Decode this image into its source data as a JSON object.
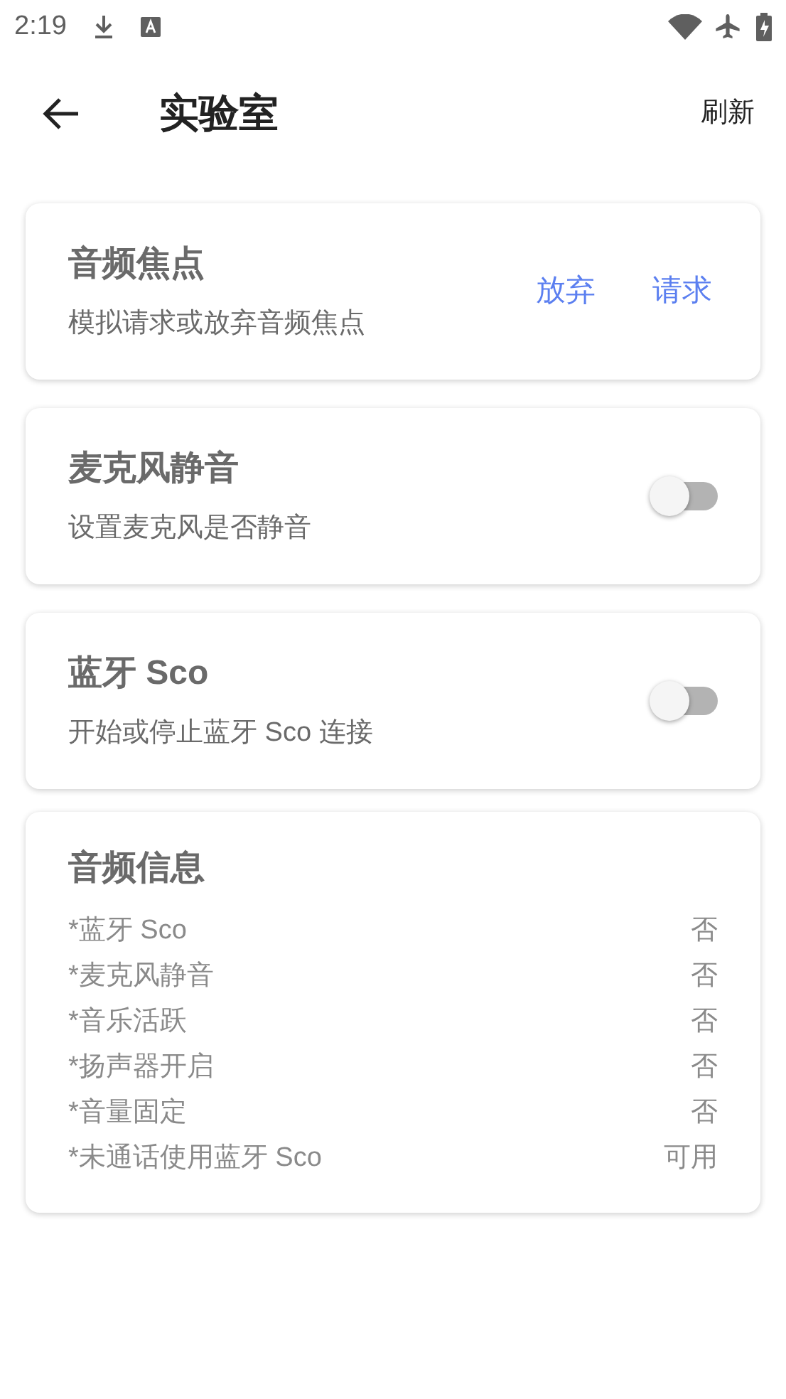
{
  "status_bar": {
    "time": "2:19"
  },
  "app_bar": {
    "title": "实验室",
    "action": "刷新"
  },
  "cards": [
    {
      "kind": "actions",
      "title": "音频焦点",
      "subtitle": "模拟请求或放弃音频焦点",
      "buttons": [
        "放弃",
        "请求"
      ]
    },
    {
      "kind": "toggle",
      "title": "麦克风静音",
      "subtitle": "设置麦克风是否静音",
      "on": false
    },
    {
      "kind": "toggle",
      "title": "蓝牙 Sco",
      "subtitle": "开始或停止蓝牙 Sco 连接",
      "on": false
    }
  ],
  "info": {
    "title": "音频信息",
    "rows": [
      {
        "label": "*蓝牙 Sco",
        "value": "否"
      },
      {
        "label": "*麦克风静音",
        "value": "否"
      },
      {
        "label": "*音乐活跃",
        "value": "否"
      },
      {
        "label": "*扬声器开启",
        "value": "否"
      },
      {
        "label": "*音量固定",
        "value": "否"
      },
      {
        "label": "*未通话使用蓝牙 Sco",
        "value": "可用"
      }
    ]
  }
}
